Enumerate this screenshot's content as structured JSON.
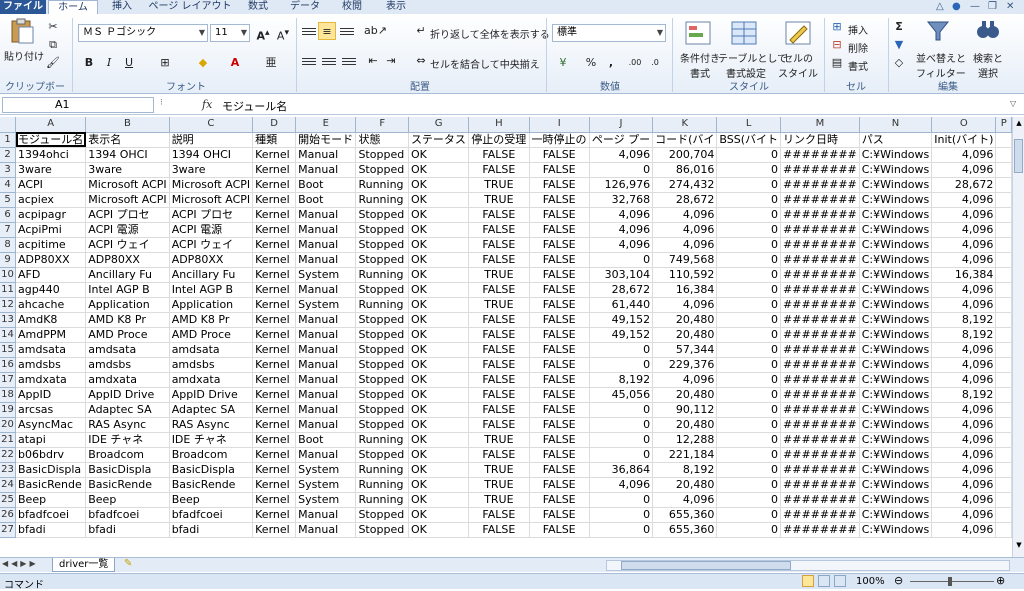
{
  "tabs": [
    "ファイル",
    "ホーム",
    "挿入",
    "ページ レイアウト",
    "数式",
    "データ",
    "校閲",
    "表示"
  ],
  "ribbon": {
    "clipboard": {
      "paste": "貼り付け",
      "label": "クリップボード"
    },
    "font": {
      "name": "ＭＳ Ｐゴシック",
      "size": "11",
      "label": "フォント"
    },
    "alignment": {
      "wrap": "折り返して全体を表示する",
      "merge": "セルを結合して中央揃え",
      "label": "配置"
    },
    "number": {
      "format": "標準",
      "label": "数値"
    },
    "styles": {
      "conditional_1": "条件付き",
      "conditional_2": "書式",
      "table_1": "テーブルとして",
      "table_2": "書式設定",
      "cell_1": "セルの",
      "cell_2": "スタイル",
      "label": "スタイル"
    },
    "cells": {
      "insert": "挿入",
      "delete": "削除",
      "format": "書式",
      "label": "セル"
    },
    "editing": {
      "sort_1": "並べ替えと",
      "sort_2": "フィルター",
      "find_1": "検索と",
      "find_2": "選択",
      "label": "編集"
    }
  },
  "formula_bar": {
    "namebox": "A1",
    "value": "モジュール名"
  },
  "columns": [
    "A",
    "B",
    "C",
    "D",
    "E",
    "F",
    "G",
    "H",
    "I",
    "J",
    "K",
    "L",
    "M",
    "N",
    "O",
    "P"
  ],
  "header_row": [
    "モジュール名",
    "表示名",
    "説明",
    "種類",
    "開始モード",
    "状態",
    "ステータス",
    "停止の受理",
    "一時停止の",
    "ページ プー",
    "コード(バイ",
    "BSS(バイト",
    "リンク日時",
    "パス",
    "Init(バイト)",
    ""
  ],
  "rows": [
    [
      "1394ohci",
      "1394 OHCI",
      "1394 OHCI",
      "Kernel",
      "Manual",
      "Stopped",
      "OK",
      "FALSE",
      "FALSE",
      "4,096",
      "200,704",
      "0",
      "########",
      "C:¥Windows",
      "4,096"
    ],
    [
      "3ware",
      "3ware",
      "3ware",
      "Kernel",
      "Manual",
      "Stopped",
      "OK",
      "FALSE",
      "FALSE",
      "0",
      "86,016",
      "0",
      "########",
      "C:¥Windows",
      "4,096"
    ],
    [
      "ACPI",
      "Microsoft ACPI",
      "Microsoft ACPI",
      "Kernel",
      "Boot",
      "Running",
      "OK",
      "TRUE",
      "FALSE",
      "126,976",
      "274,432",
      "0",
      "########",
      "C:¥Windows",
      "28,672"
    ],
    [
      "acpiex",
      "Microsoft ACPI",
      "Microsoft ACPI",
      "Kernel",
      "Boot",
      "Running",
      "OK",
      "TRUE",
      "FALSE",
      "32,768",
      "28,672",
      "0",
      "########",
      "C:¥Windows",
      "4,096"
    ],
    [
      "acpipagr",
      "ACPI プロセ",
      "ACPI プロセ",
      "Kernel",
      "Manual",
      "Stopped",
      "OK",
      "FALSE",
      "FALSE",
      "4,096",
      "4,096",
      "0",
      "########",
      "C:¥Windows",
      "4,096"
    ],
    [
      "AcpiPmi",
      "ACPI 電源",
      "ACPI 電源",
      "Kernel",
      "Manual",
      "Stopped",
      "OK",
      "FALSE",
      "FALSE",
      "4,096",
      "4,096",
      "0",
      "########",
      "C:¥Windows",
      "4,096"
    ],
    [
      "acpitime",
      "ACPI ウェイ",
      "ACPI ウェイ",
      "Kernel",
      "Manual",
      "Stopped",
      "OK",
      "FALSE",
      "FALSE",
      "4,096",
      "4,096",
      "0",
      "########",
      "C:¥Windows",
      "4,096"
    ],
    [
      "ADP80XX",
      "ADP80XX",
      "ADP80XX",
      "Kernel",
      "Manual",
      "Stopped",
      "OK",
      "FALSE",
      "FALSE",
      "0",
      "749,568",
      "0",
      "########",
      "C:¥Windows",
      "4,096"
    ],
    [
      "AFD",
      "Ancillary Fu",
      "Ancillary Fu",
      "Kernel",
      "System",
      "Running",
      "OK",
      "TRUE",
      "FALSE",
      "303,104",
      "110,592",
      "0",
      "########",
      "C:¥Windows",
      "16,384"
    ],
    [
      "agp440",
      "Intel AGP B",
      "Intel AGP B",
      "Kernel",
      "Manual",
      "Stopped",
      "OK",
      "FALSE",
      "FALSE",
      "28,672",
      "16,384",
      "0",
      "########",
      "C:¥Windows",
      "4,096"
    ],
    [
      "ahcache",
      "Application",
      "Application",
      "Kernel",
      "System",
      "Running",
      "OK",
      "TRUE",
      "FALSE",
      "61,440",
      "4,096",
      "0",
      "########",
      "C:¥Windows",
      "4,096"
    ],
    [
      "AmdK8",
      "AMD K8 Pr",
      "AMD K8 Pr",
      "Kernel",
      "Manual",
      "Stopped",
      "OK",
      "FALSE",
      "FALSE",
      "49,152",
      "20,480",
      "0",
      "########",
      "C:¥Windows",
      "8,192"
    ],
    [
      "AmdPPM",
      "AMD Proce",
      "AMD Proce",
      "Kernel",
      "Manual",
      "Stopped",
      "OK",
      "FALSE",
      "FALSE",
      "49,152",
      "20,480",
      "0",
      "########",
      "C:¥Windows",
      "8,192"
    ],
    [
      "amdsata",
      "amdsata",
      "amdsata",
      "Kernel",
      "Manual",
      "Stopped",
      "OK",
      "FALSE",
      "FALSE",
      "0",
      "57,344",
      "0",
      "########",
      "C:¥Windows",
      "4,096"
    ],
    [
      "amdsbs",
      "amdsbs",
      "amdsbs",
      "Kernel",
      "Manual",
      "Stopped",
      "OK",
      "FALSE",
      "FALSE",
      "0",
      "229,376",
      "0",
      "########",
      "C:¥Windows",
      "4,096"
    ],
    [
      "amdxata",
      "amdxata",
      "amdxata",
      "Kernel",
      "Manual",
      "Stopped",
      "OK",
      "FALSE",
      "FALSE",
      "8,192",
      "4,096",
      "0",
      "########",
      "C:¥Windows",
      "4,096"
    ],
    [
      "AppID",
      "AppID Drive",
      "AppID Drive",
      "Kernel",
      "Manual",
      "Stopped",
      "OK",
      "FALSE",
      "FALSE",
      "45,056",
      "20,480",
      "0",
      "########",
      "C:¥Windows",
      "8,192"
    ],
    [
      "arcsas",
      "Adaptec SA",
      "Adaptec SA",
      "Kernel",
      "Manual",
      "Stopped",
      "OK",
      "FALSE",
      "FALSE",
      "0",
      "90,112",
      "0",
      "########",
      "C:¥Windows",
      "4,096"
    ],
    [
      "AsyncMac",
      "RAS Async",
      "RAS Async",
      "Kernel",
      "Manual",
      "Stopped",
      "OK",
      "FALSE",
      "FALSE",
      "0",
      "20,480",
      "0",
      "########",
      "C:¥Windows",
      "4,096"
    ],
    [
      "atapi",
      "IDE チャネ",
      "IDE チャネ",
      "Kernel",
      "Boot",
      "Running",
      "OK",
      "TRUE",
      "FALSE",
      "0",
      "12,288",
      "0",
      "########",
      "C:¥Windows",
      "4,096"
    ],
    [
      "b06bdrv",
      "Broadcom",
      "Broadcom",
      "Kernel",
      "Manual",
      "Stopped",
      "OK",
      "FALSE",
      "FALSE",
      "0",
      "221,184",
      "0",
      "########",
      "C:¥Windows",
      "4,096"
    ],
    [
      "BasicDispla",
      "BasicDispla",
      "BasicDispla",
      "Kernel",
      "System",
      "Running",
      "OK",
      "TRUE",
      "FALSE",
      "36,864",
      "8,192",
      "0",
      "########",
      "C:¥Windows",
      "4,096"
    ],
    [
      "BasicRende",
      "BasicRende",
      "BasicRende",
      "Kernel",
      "System",
      "Running",
      "OK",
      "TRUE",
      "FALSE",
      "4,096",
      "20,480",
      "0",
      "########",
      "C:¥Windows",
      "4,096"
    ],
    [
      "Beep",
      "Beep",
      "Beep",
      "Kernel",
      "System",
      "Running",
      "OK",
      "TRUE",
      "FALSE",
      "0",
      "4,096",
      "0",
      "########",
      "C:¥Windows",
      "4,096"
    ],
    [
      "bfadfcoei",
      "bfadfcoei",
      "bfadfcoei",
      "Kernel",
      "Manual",
      "Stopped",
      "OK",
      "FALSE",
      "FALSE",
      "0",
      "655,360",
      "0",
      "########",
      "C:¥Windows",
      "4,096"
    ],
    [
      "bfadi",
      "bfadi",
      "bfadi",
      "Kernel",
      "Manual",
      "Stopped",
      "OK",
      "FALSE",
      "FALSE",
      "0",
      "655,360",
      "0",
      "########",
      "C:¥Windows",
      "4,096"
    ]
  ],
  "sheet_tab": "driver一覧",
  "status": {
    "mode": "コマンド",
    "zoom": "100%"
  }
}
